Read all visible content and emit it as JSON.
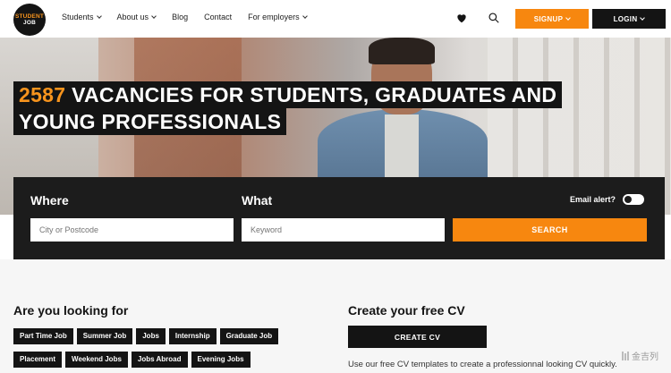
{
  "header": {
    "logo_line1": "STUDENT",
    "logo_line2": "JOB",
    "nav": [
      {
        "label": "Students",
        "dropdown": true
      },
      {
        "label": "About us",
        "dropdown": true
      },
      {
        "label": "Blog",
        "dropdown": false
      },
      {
        "label": "Contact",
        "dropdown": false
      },
      {
        "label": "For employers",
        "dropdown": true
      }
    ],
    "icons": [
      "heart-icon",
      "search-icon"
    ],
    "signup_label": "SIGNUP",
    "login_label": "LOGIN"
  },
  "hero": {
    "vacancy_count": "2587",
    "headline_line1_rest": "VACANCIES FOR STUDENTS, GRADUATES AND",
    "headline_line2": "YOUNG PROFESSIONALS"
  },
  "search": {
    "where_label": "Where",
    "what_label": "What",
    "email_alert_label": "Email alert?",
    "where_placeholder": "City or Postcode",
    "what_placeholder": "Keyword",
    "search_label": "SEARCH"
  },
  "looking_for": {
    "heading": "Are you looking for",
    "tags": [
      "Part Time Job",
      "Summer Job",
      "Jobs",
      "Internship",
      "Graduate Job",
      "Placement",
      "Weekend Jobs",
      "Jobs Abroad",
      "Evening Jobs"
    ]
  },
  "cv": {
    "heading": "Create your free CV",
    "button_label": "CREATE CV",
    "text": "Use our free CV templates to create a professionnal looking CV quickly."
  },
  "watermark": "金吉列",
  "colors": {
    "accent": "#f7870f",
    "dark": "#141414"
  }
}
